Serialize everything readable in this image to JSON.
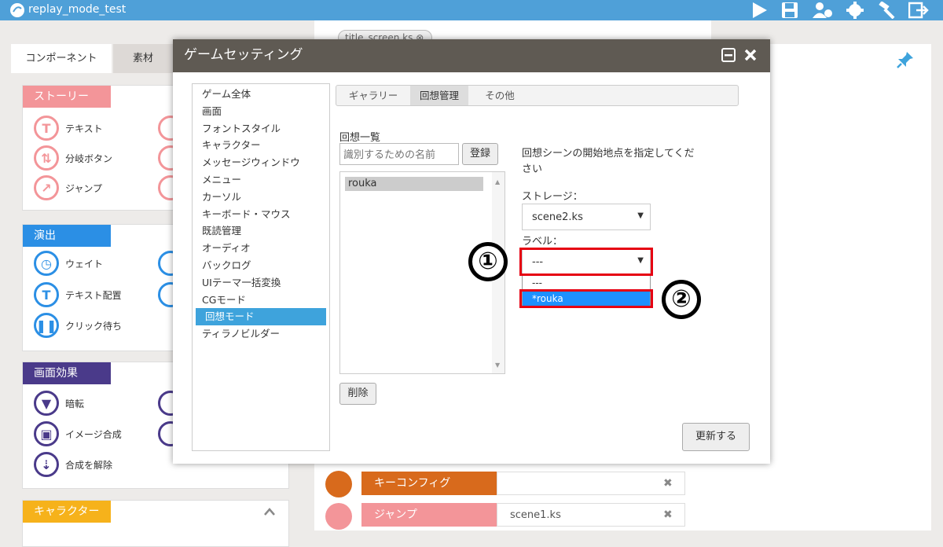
{
  "app": {
    "title": "replay_mode_test"
  },
  "left_tabs": [
    "コンポーネント",
    "素材"
  ],
  "sections": [
    {
      "title": "ストーリー",
      "color": "#f39599",
      "items": [
        "テキスト",
        "分岐ボタン",
        "ジャンプ"
      ]
    },
    {
      "title": "演出",
      "color": "#2b8fe5",
      "items": [
        "ウェイト",
        "テキスト配置",
        "クリック待ち"
      ]
    },
    {
      "title": "画面効果",
      "color": "#4a3a8a",
      "items": [
        "暗転",
        "イメージ合成",
        "合成を解除"
      ]
    },
    {
      "title": "キャラクター",
      "color": "#f6b21b",
      "items": []
    }
  ],
  "file_tab": "title_screen.ks",
  "timeline": [
    {
      "name": "キーコンフィグ",
      "value": "",
      "color": "#d86a1c"
    },
    {
      "name": "ジャンプ",
      "value": "scene1.ks",
      "color": "#f39599"
    }
  ],
  "dialog": {
    "title": "ゲームセッティング",
    "categories": [
      "ゲーム全体",
      "画面",
      "フォントスタイル",
      "キャラクター",
      "メッセージウィンドウ",
      "メニュー",
      "カーソル",
      "キーボード・マウス",
      "既読管理",
      "オーディオ",
      "バックログ",
      "UIテーマ一括変換",
      "CGモード",
      "回想モード",
      "ティラノビルダー"
    ],
    "selected_category": "回想モード",
    "tabs": [
      "ギャラリー",
      "回想管理",
      "その他"
    ],
    "active_tab": "回想管理",
    "list_label": "回想一覧",
    "name_placeholder": "識別するための名前",
    "register_label": "登録",
    "list_items": [
      "rouka"
    ],
    "delete_label": "削除",
    "instruction": "回想シーンの開始地点を指定してください",
    "storage_label": "ストレージ：",
    "storage_value": "scene2.ks",
    "label_label": "ラベル：",
    "label_value": "---",
    "label_options": [
      "---",
      "*rouka"
    ],
    "update_label": "更新する"
  },
  "annotations": [
    "①",
    "②"
  ]
}
